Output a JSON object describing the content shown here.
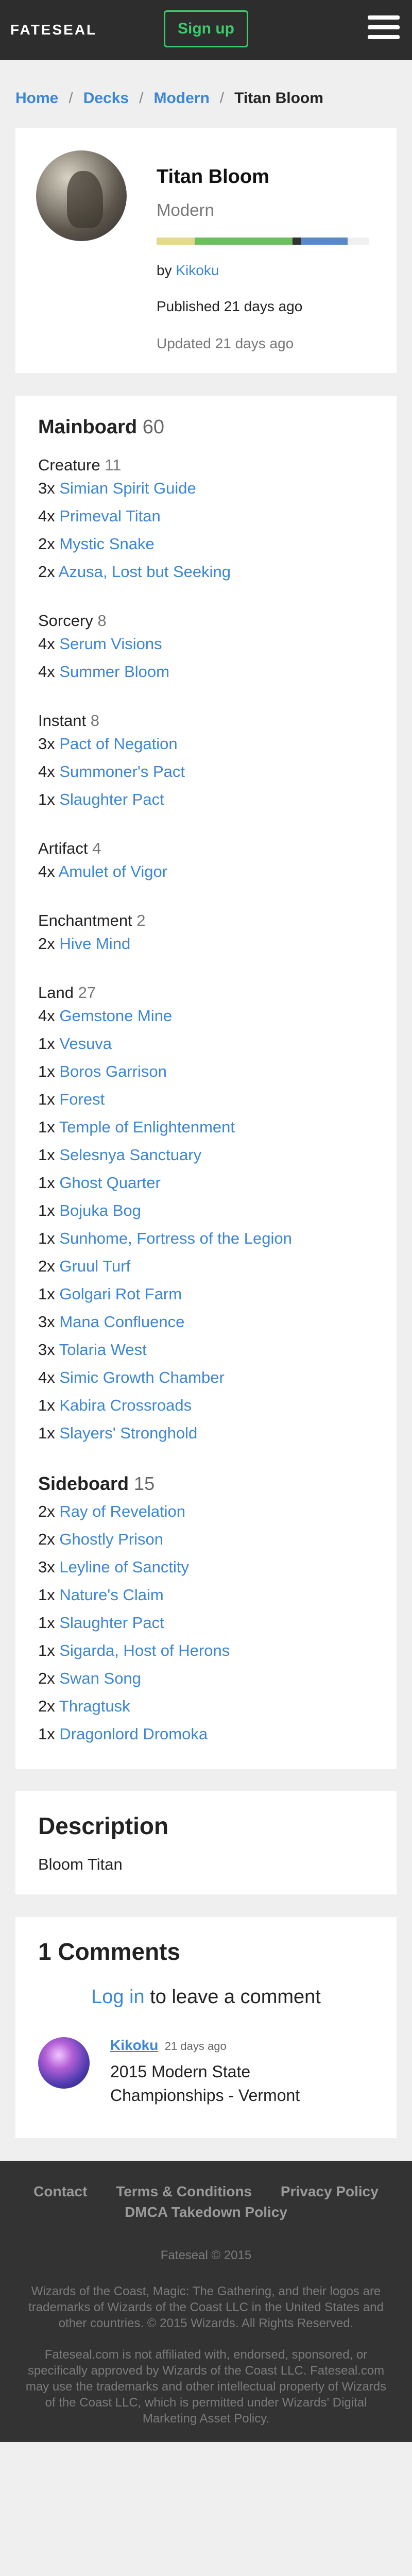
{
  "nav": {
    "logo": "FATESEAL",
    "signup": "Sign up"
  },
  "breadcrumb": {
    "home": "Home",
    "decks": "Decks",
    "format": "Modern",
    "current": "Titan Bloom",
    "sep": "/"
  },
  "deck": {
    "title": "Titan Bloom",
    "format": "Modern",
    "by_prefix": "by",
    "author": "Kikoku",
    "published": "Published 21 days ago",
    "updated": "Updated 21 days ago",
    "color_segments": [
      {
        "color": "#e3d98f",
        "share": 0.18
      },
      {
        "color": "#6cbf5f",
        "share": 0.46
      },
      {
        "color": "#333333",
        "share": 0.04
      },
      {
        "color": "#5a8ac6",
        "share": 0.22
      },
      {
        "color": "#f0f0f0",
        "share": 0.1
      }
    ]
  },
  "mainboard": {
    "title": "Mainboard",
    "count": "60",
    "groups": [
      {
        "name": "Creature",
        "count": "11",
        "cards": [
          {
            "qty": "3x",
            "name": "Simian Spirit Guide"
          },
          {
            "qty": "4x",
            "name": "Primeval Titan"
          },
          {
            "qty": "2x",
            "name": "Mystic Snake"
          },
          {
            "qty": "2x",
            "name": "Azusa, Lost but Seeking"
          }
        ]
      },
      {
        "name": "Sorcery",
        "count": "8",
        "cards": [
          {
            "qty": "4x",
            "name": "Serum Visions"
          },
          {
            "qty": "4x",
            "name": "Summer Bloom"
          }
        ]
      },
      {
        "name": "Instant",
        "count": "8",
        "cards": [
          {
            "qty": "3x",
            "name": "Pact of Negation"
          },
          {
            "qty": "4x",
            "name": "Summoner's Pact"
          },
          {
            "qty": "1x",
            "name": "Slaughter Pact"
          }
        ]
      },
      {
        "name": "Artifact",
        "count": "4",
        "cards": [
          {
            "qty": "4x",
            "name": "Amulet of Vigor"
          }
        ]
      },
      {
        "name": "Enchantment",
        "count": "2",
        "cards": [
          {
            "qty": "2x",
            "name": "Hive Mind"
          }
        ]
      },
      {
        "name": "Land",
        "count": "27",
        "cards": [
          {
            "qty": "4x",
            "name": "Gemstone Mine"
          },
          {
            "qty": "1x",
            "name": "Vesuva"
          },
          {
            "qty": "1x",
            "name": "Boros Garrison"
          },
          {
            "qty": "1x",
            "name": "Forest"
          },
          {
            "qty": "1x",
            "name": "Temple of Enlightenment"
          },
          {
            "qty": "1x",
            "name": "Selesnya Sanctuary"
          },
          {
            "qty": "1x",
            "name": "Ghost Quarter"
          },
          {
            "qty": "1x",
            "name": "Bojuka Bog"
          },
          {
            "qty": "1x",
            "name": "Sunhome, Fortress of the Legion"
          },
          {
            "qty": "2x",
            "name": "Gruul Turf"
          },
          {
            "qty": "1x",
            "name": "Golgari Rot Farm"
          },
          {
            "qty": "3x",
            "name": "Mana Confluence"
          },
          {
            "qty": "3x",
            "name": "Tolaria West"
          },
          {
            "qty": "4x",
            "name": "Simic Growth Chamber"
          },
          {
            "qty": "1x",
            "name": "Kabira Crossroads"
          },
          {
            "qty": "1x",
            "name": "Slayers' Stronghold"
          }
        ]
      }
    ]
  },
  "sideboard": {
    "title": "Sideboard",
    "count": "15",
    "cards": [
      {
        "qty": "2x",
        "name": "Ray of Revelation"
      },
      {
        "qty": "2x",
        "name": "Ghostly Prison"
      },
      {
        "qty": "3x",
        "name": "Leyline of Sanctity"
      },
      {
        "qty": "1x",
        "name": "Nature's Claim"
      },
      {
        "qty": "1x",
        "name": "Slaughter Pact"
      },
      {
        "qty": "1x",
        "name": "Sigarda, Host of Herons"
      },
      {
        "qty": "2x",
        "name": "Swan Song"
      },
      {
        "qty": "2x",
        "name": "Thragtusk"
      },
      {
        "qty": "1x",
        "name": "Dragonlord Dromoka"
      }
    ]
  },
  "description": {
    "title": "Description",
    "text": "Bloom Titan"
  },
  "comments": {
    "title": "1 Comments",
    "login_link": "Log in",
    "login_suffix": " to leave a comment",
    "items": [
      {
        "author": "Kikoku",
        "time": "21 days ago",
        "text": "2015 Modern State Championships - Vermont"
      }
    ]
  },
  "footer": {
    "links": [
      "Contact",
      "Terms & Conditions",
      "Privacy Policy",
      "DMCA Takedown Policy"
    ],
    "copyright": "Fateseal © 2015",
    "legal1": "Wizards of the Coast, Magic: The Gathering, and their logos are trademarks of Wizards of the Coast LLC in the United States and other countries. © 2015 Wizards. All Rights Reserved.",
    "legal2": "Fateseal.com is not affiliated with, endorsed, sponsored, or specifically approved by Wizards of the Coast LLC. Fateseal.com may use the trademarks and other intellectual property of Wizards of the Coast LLC, which is permitted under Wizards' Digital Marketing Asset Policy."
  }
}
